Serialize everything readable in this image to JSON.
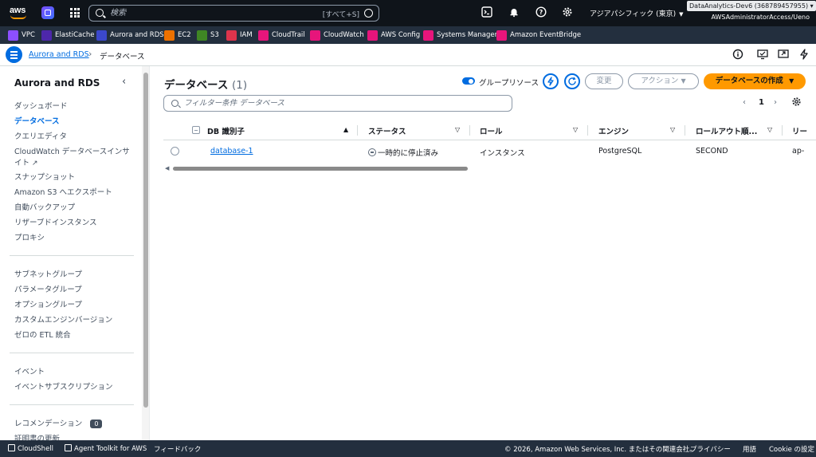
{
  "topnav": {
    "logo_text": "aws",
    "search_placeholder": "検索",
    "search_shortcut": "[すべて+S]",
    "region": "アジアパシフィック (東京)",
    "account_name": "DataAnalytics-Dev6 (368789457955)",
    "account_role": "AWSAdministratorAccess/Ueno"
  },
  "favorites": [
    {
      "label": "VPC",
      "color": "#8c4fff"
    },
    {
      "label": "ElastiCache",
      "color": "#4d27aa"
    },
    {
      "label": "Aurora and RDS",
      "color": "#3b48cc"
    },
    {
      "label": "EC2",
      "color": "#ed7100"
    },
    {
      "label": "S3",
      "color": "#3f8624"
    },
    {
      "label": "IAM",
      "color": "#dd344c"
    },
    {
      "label": "CloudTrail",
      "color": "#e7157b"
    },
    {
      "label": "CloudWatch",
      "color": "#e7157b"
    },
    {
      "label": "AWS Config",
      "color": "#e7157b"
    },
    {
      "label": "Systems Manager",
      "color": "#e7157b"
    },
    {
      "label": "Amazon EventBridge",
      "color": "#e7157b"
    }
  ],
  "breadcrumb": {
    "parent": "Aurora and RDS",
    "current": "データベース"
  },
  "sidebar": {
    "title": "Aurora and RDS",
    "group1": [
      "ダッシュボード",
      "データベース",
      "クエリエディタ",
      "CloudWatch データベースインサ",
      "イト",
      "スナップショット",
      "Amazon S3 へエクスポート",
      "自動バックアップ",
      "リザーブドインスタンス",
      "プロキシ"
    ],
    "group2": [
      "サブネットグループ",
      "パラメータグループ",
      "オプショングループ",
      "カスタムエンジンバージョン",
      "ゼロの ETL 統合"
    ],
    "group3": [
      "イベント",
      "イベントサブスクリプション"
    ],
    "group4_recommend": "レコメンデーション",
    "recommend_count": "0",
    "group4_cert": "証明書の更新"
  },
  "main": {
    "title": "データベース",
    "count": "(1)",
    "group_resources": "グループリソース",
    "modify": "変更",
    "actions": "アクション",
    "create": "データベースの作成",
    "filter_placeholder": "フィルター条件 データベース",
    "page": "1"
  },
  "table": {
    "headers": [
      "DB 識別子",
      "ステータス",
      "ロール",
      "エンジン",
      "ロールアウト順...",
      "リー"
    ],
    "rows": [
      {
        "id": "database-1",
        "status": "一時的に停止済み",
        "role": "インスタンス",
        "engine": "PostgreSQL",
        "rollout": "SECOND",
        "region": "ap-"
      }
    ]
  },
  "footer": {
    "cloudshell": "CloudShell",
    "toolkit": "Agent Toolkit for AWS",
    "feedback": "フィードバック",
    "copyright": "© 2026, Amazon Web Services, Inc. またはその関連会社。",
    "privacy": "プライバシー",
    "terms": "用語",
    "cookie": "Cookie の設定"
  },
  "colors": {
    "primary": "#ff9900",
    "link": "#006ce0",
    "nav_bg": "#0f141a",
    "fav_bg": "#232f3e"
  }
}
